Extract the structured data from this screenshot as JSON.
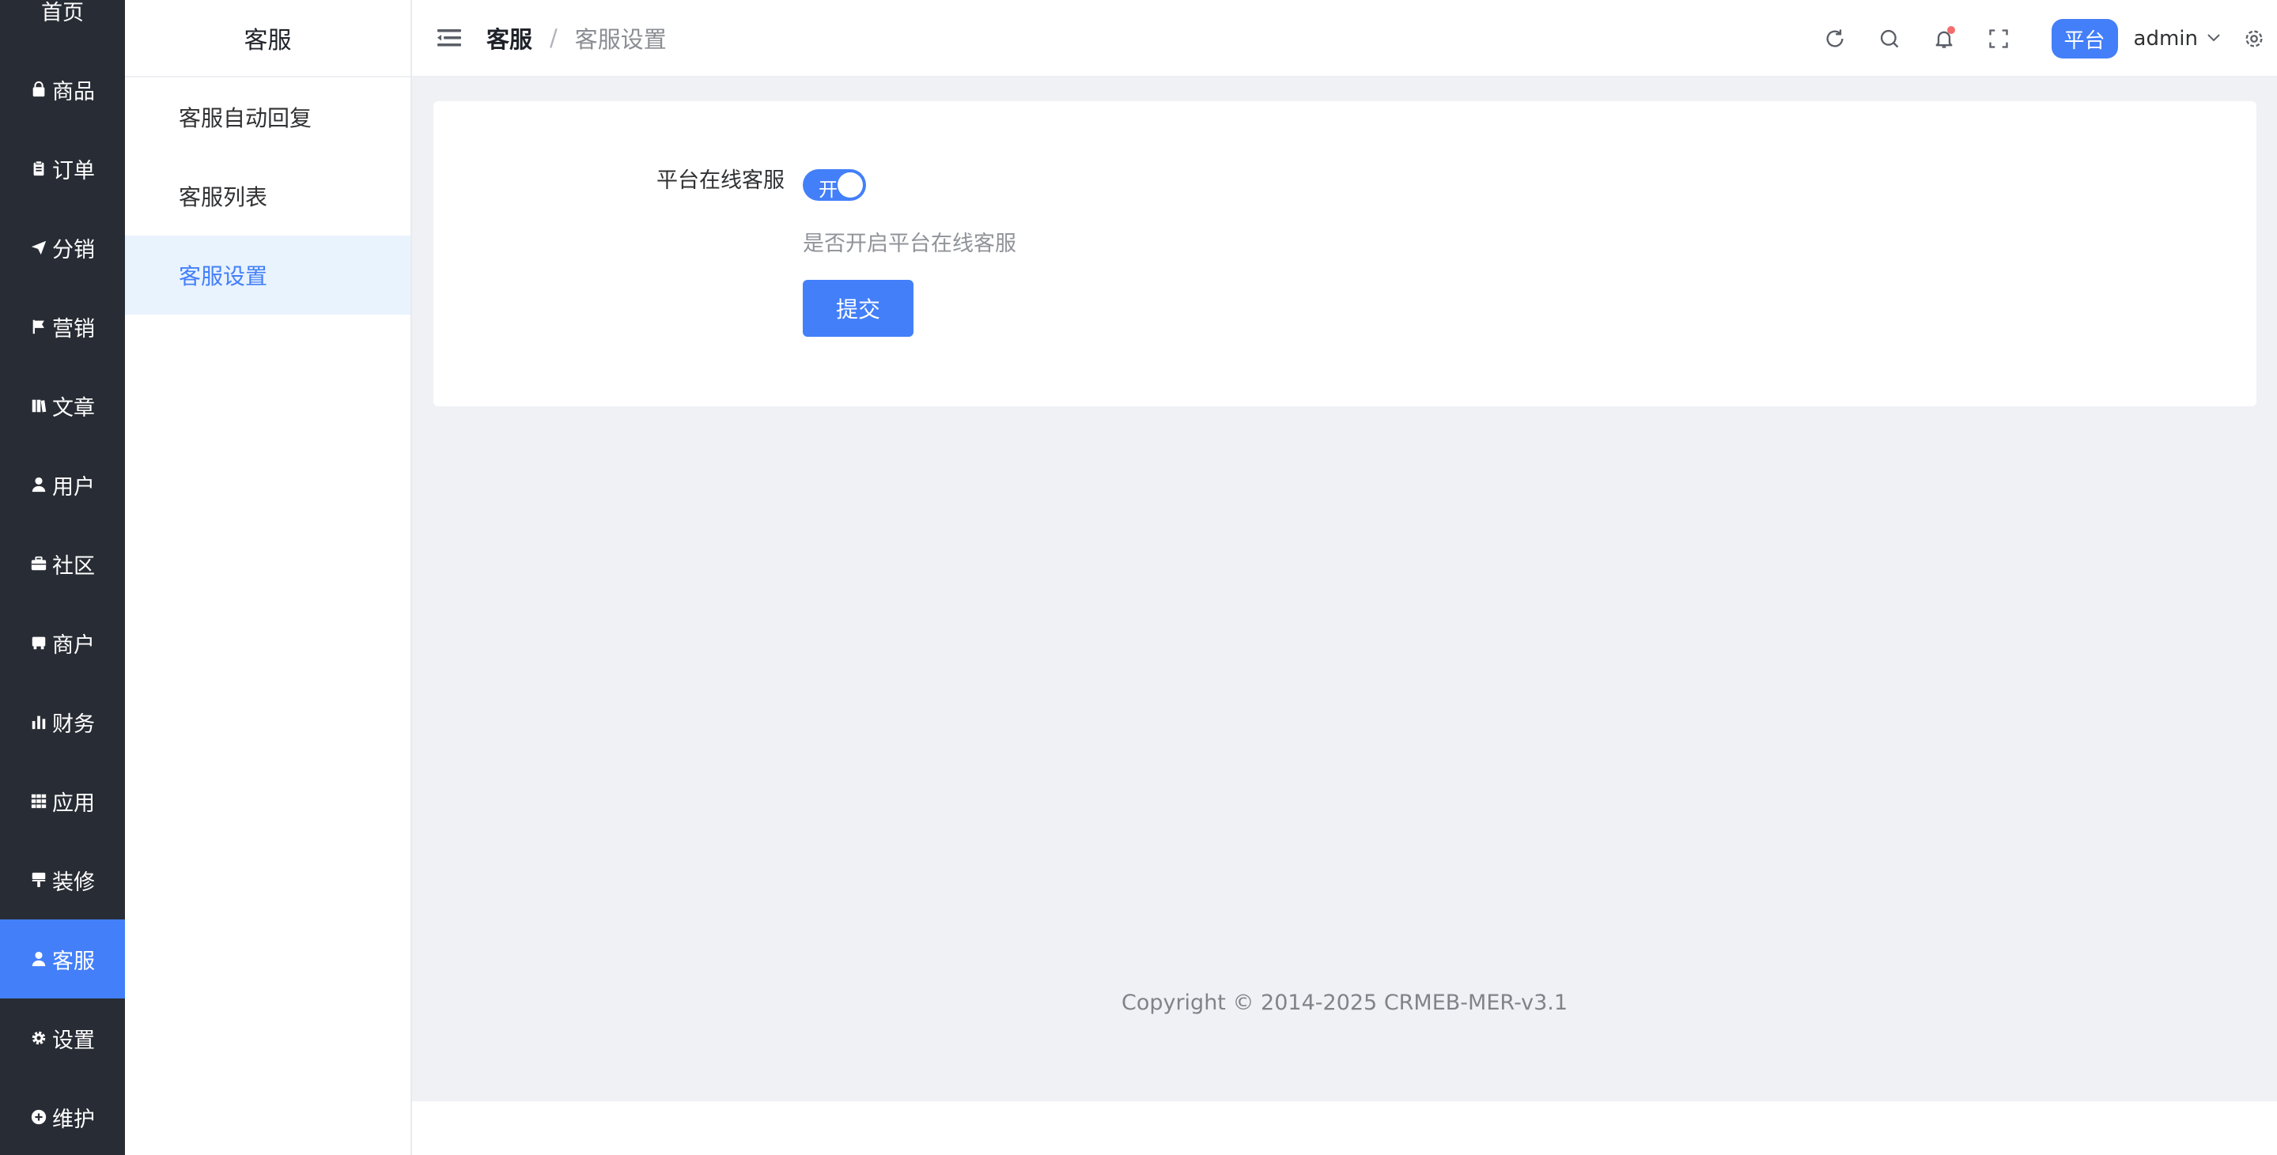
{
  "nav": {
    "items": [
      {
        "label": "首页",
        "icon": "home-icon",
        "active": false
      },
      {
        "label": "商品",
        "icon": "bag-icon",
        "active": false
      },
      {
        "label": "订单",
        "icon": "clipboard-icon",
        "active": false
      },
      {
        "label": "分销",
        "icon": "send-icon",
        "active": false
      },
      {
        "label": "营销",
        "icon": "flag-icon",
        "active": false
      },
      {
        "label": "文章",
        "icon": "book-icon",
        "active": false
      },
      {
        "label": "用户",
        "icon": "user-icon",
        "active": false
      },
      {
        "label": "社区",
        "icon": "briefcase-icon",
        "active": false
      },
      {
        "label": "商户",
        "icon": "shop-icon",
        "active": false
      },
      {
        "label": "财务",
        "icon": "bar-chart-icon",
        "active": false
      },
      {
        "label": "应用",
        "icon": "grid-icon",
        "active": false
      },
      {
        "label": "装修",
        "icon": "paint-roller-icon",
        "active": false
      },
      {
        "label": "客服",
        "icon": "user-icon",
        "active": true
      },
      {
        "label": "设置",
        "icon": "gear-icon",
        "active": false
      },
      {
        "label": "维护",
        "icon": "plus-circle-icon",
        "active": false
      }
    ]
  },
  "subnav": {
    "title": "客服",
    "items": [
      {
        "label": "客服自动回复",
        "active": false
      },
      {
        "label": "客服列表",
        "active": false
      },
      {
        "label": "客服设置",
        "active": true
      }
    ]
  },
  "header": {
    "breadcrumb": {
      "parent": "客服",
      "separator": "/",
      "current": "客服设置"
    },
    "platform_tag": "平台",
    "user_name": "admin"
  },
  "form": {
    "online_service_label": "平台在线客服",
    "switch_text": "开",
    "switch_on": true,
    "hint": "是否开启平台在线客服",
    "submit_label": "提交"
  },
  "footer": {
    "copyright": "Copyright © 2014-2025 CRMEB-MER-v3.1"
  },
  "colors": {
    "sidebar_bg": "#282c34",
    "accent": "#437ff9",
    "content_bg": "#f0f1f5",
    "subnav_active_bg": "#e8f3fe"
  }
}
